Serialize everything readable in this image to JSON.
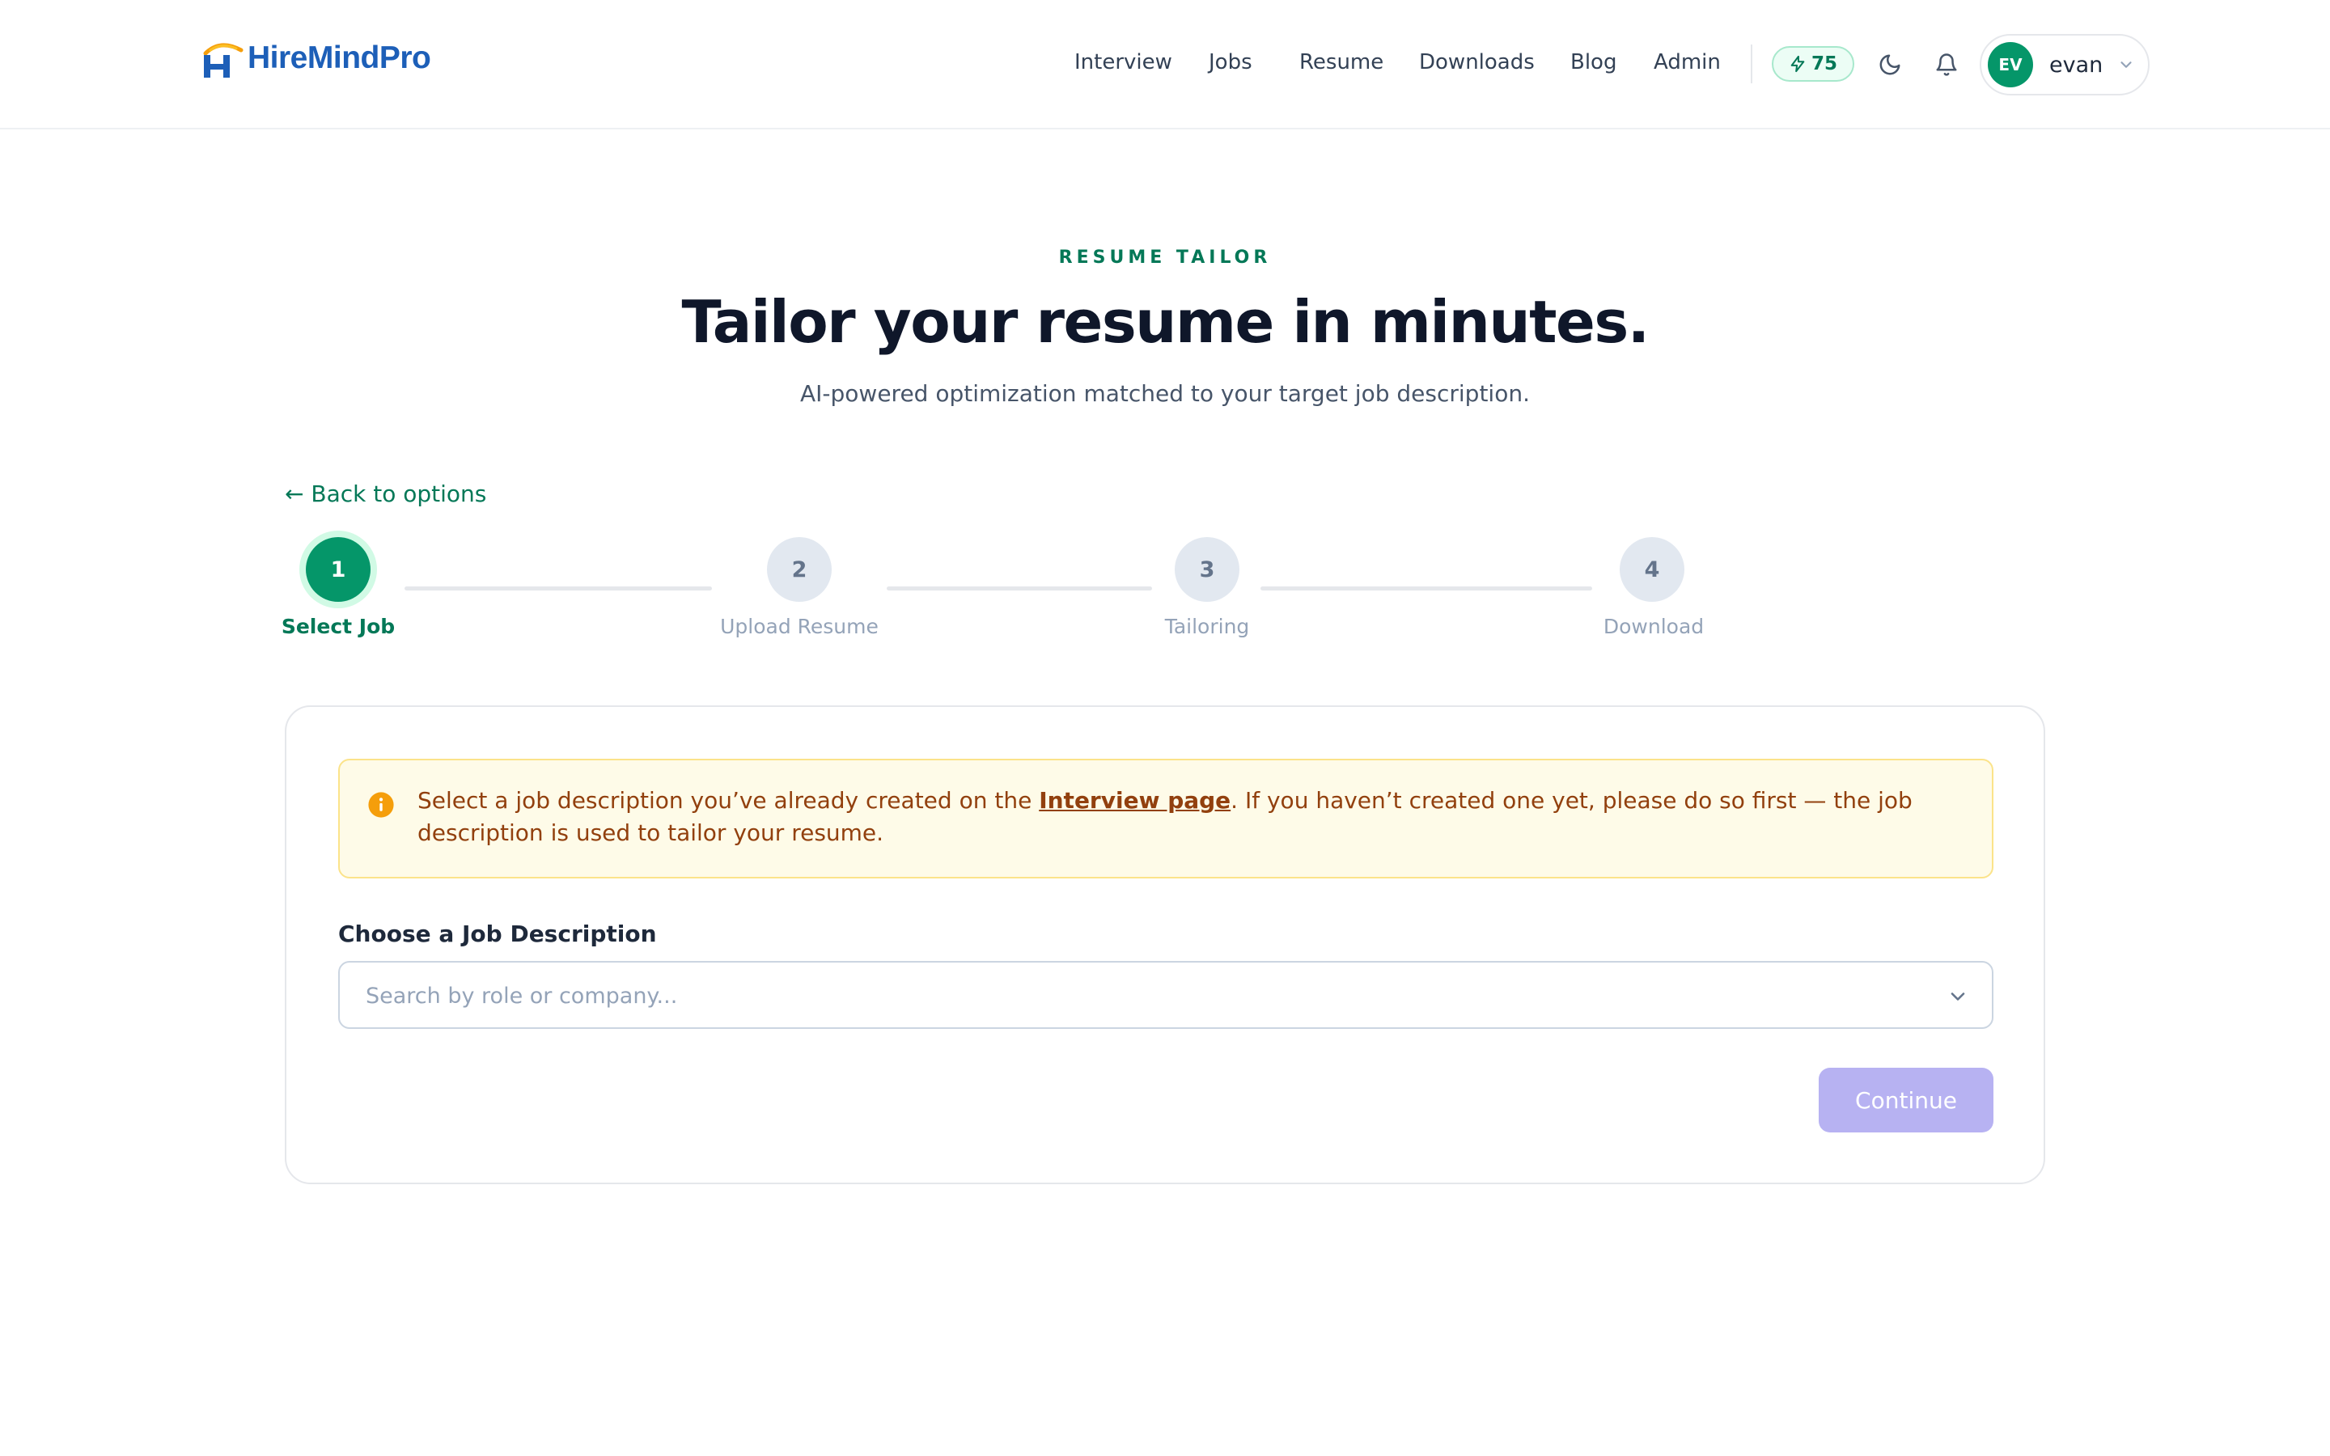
{
  "brand": {
    "name": "HireMindPro"
  },
  "nav": {
    "links": [
      "Interview",
      "Jobs",
      "Resume",
      "Downloads",
      "Blog",
      "Admin"
    ],
    "credits": "75",
    "user": {
      "initials": "EV",
      "name": "evan"
    }
  },
  "hero": {
    "eyebrow": "RESUME TAILOR",
    "title": "Tailor your resume in minutes.",
    "subtitle": "AI-powered optimization matched to your target job description."
  },
  "back_link": "← Back to options",
  "steps": [
    {
      "number": "1",
      "label": "Select Job",
      "state": "active"
    },
    {
      "number": "2",
      "label": "Upload Resume",
      "state": "pending"
    },
    {
      "number": "3",
      "label": "Tailoring",
      "state": "pending"
    },
    {
      "number": "4",
      "label": "Download",
      "state": "pending"
    }
  ],
  "notice": {
    "text_before": "Select a job description you’ve already created on the ",
    "link_text": "Interview page",
    "text_after": ". If you haven’t created one yet, please do so first — the job description is used to tailor your resume."
  },
  "job_select": {
    "label": "Choose a Job Description",
    "placeholder": "Search by role or company...",
    "value": ""
  },
  "continue_label": "Continue",
  "colors": {
    "accent": "#059669",
    "brand_blue": "#1d5fb8",
    "brand_orange": "#f59e0b",
    "notice_bg": "#fefbe8",
    "button_disabled": "#b7b2f2"
  }
}
